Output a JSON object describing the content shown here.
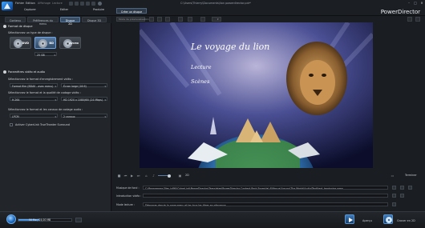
{
  "window": {
    "menu_items": [
      "Fichier",
      "Edition",
      "Affichage",
      "Lecture"
    ],
    "path_title": "C:\\Users\\Thierry\\Documents\\lion powerdirector.pdr*",
    "brand": "PowerDirector",
    "controls": {
      "minimize": "–",
      "maximize": "□",
      "close": "×"
    }
  },
  "modules": {
    "items": [
      "Capturer",
      "Editer",
      "Produire"
    ],
    "active_subtab": "Créer un disque"
  },
  "left_tabs": [
    "Contenu",
    "Préférences du menu",
    "Disque 2D",
    "Disque 3D"
  ],
  "active_tab_index": 2,
  "disc_format": {
    "heading": "Format de disque",
    "select_label": "Sélectionnez un type de disque :",
    "options": [
      {
        "label": "DVD",
        "selected": false
      },
      {
        "label": "BD",
        "selected": true
      },
      {
        "label": "AVCHD",
        "selected": false
      }
    ],
    "size_value": "25 GB"
  },
  "video_audio": {
    "heading": "Paramètres vidéo et audio",
    "recording_format_label": "Sélectionnez le format d'enregistrement vidéo :",
    "recording_format_value": "Format film (BDAV - avec menu)",
    "aspect_value": "Écran large (16:9)",
    "quality_label": "Sélectionnez le format et la qualité de codage vidéo :",
    "codec_value": "H.264",
    "quality_value": "HD 1920 x 1080/60i (24 Mbps)",
    "audio_label": "Sélectionnez le format et les canaux de codage audio :",
    "audio_format_value": "LPCM",
    "audio_channels_value": "2 canaux",
    "surround_checkbox_label": "Activer CyberLink TrueTheater Surround"
  },
  "preview_toolbar": {
    "mode_label": "Mode de prévisualisation",
    "options": [
      "▾"
    ]
  },
  "menu_preview": {
    "title": "Le voyage du lion",
    "items": [
      "Lecture",
      "Scènes"
    ]
  },
  "playback": {
    "mode_2d": "2D",
    "finish_button": "Terminer"
  },
  "menu_settings": {
    "music_label": "Musique de fond :",
    "music_value": "C:\\Programme Files (x86)\\CyberLink\\PowerDirector\\Templates\\PowerDirector Content Pack Essential 4\\Menus\\Around The World\\Audio\\Text\\text_beginning.wma",
    "intro_label": "Introduction vidéo :",
    "intro_value": "",
    "mode_label": "Mode lecture :",
    "mode_value": "Démarrer depuis la page menu et les tous les titres en séquence"
  },
  "bottom": {
    "capacity_text": "50 Mo / 24,00 MB",
    "capacity_fraction": 0.4,
    "apercu_label": "Aperçu",
    "burn_label": "Graver en 2D"
  },
  "colors": {
    "accent": "#2f7ad0",
    "panel": "#22262b",
    "preview_bg": "#050607"
  }
}
